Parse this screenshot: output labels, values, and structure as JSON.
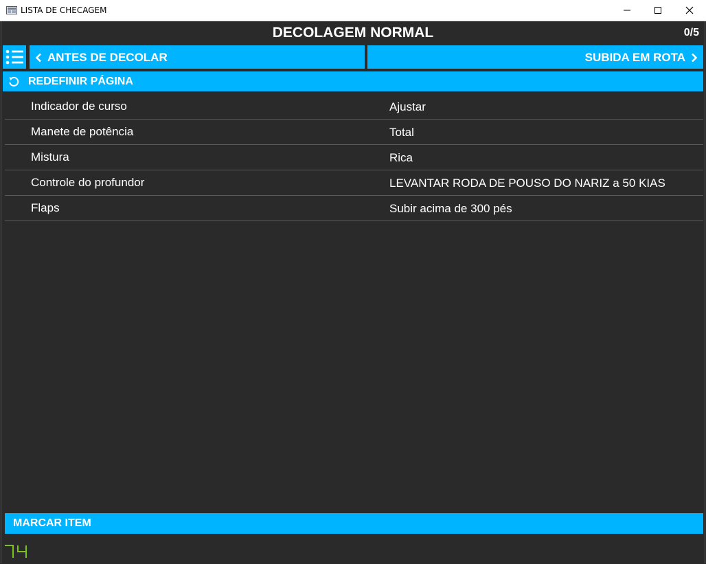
{
  "window": {
    "title": "LISTA DE CHECAGEM"
  },
  "header": {
    "title": "DECOLAGEM NORMAL",
    "progress": "0/5"
  },
  "nav": {
    "prev_label": "ANTES DE DECOLAR",
    "next_label": "SUBIDA EM ROTA",
    "reset_label": "REDEFINIR PÁGINA"
  },
  "checklist": {
    "items": [
      {
        "item": "Indicador de curso",
        "action": "Ajustar"
      },
      {
        "item": "Manete de potência",
        "action": "Total"
      },
      {
        "item": "Mistura",
        "action": "Rica"
      },
      {
        "item": "Controle do profundor",
        "action": "LEVANTAR RODA DE POUSO DO NARIZ a 50 KIAS"
      },
      {
        "item": "Flaps",
        "action": "Subir acima de 300 pés"
      }
    ]
  },
  "footer": {
    "mark_label": "MARCAR ITEM",
    "fps_counter": "74"
  },
  "colors": {
    "accent": "#00b4ff",
    "background": "#2a2a2a",
    "fps_green": "#7ac41a"
  },
  "icons": {
    "menu": "list-icon",
    "prev": "chevron-left-icon",
    "next": "chevron-right-icon",
    "reset": "reset-icon"
  }
}
